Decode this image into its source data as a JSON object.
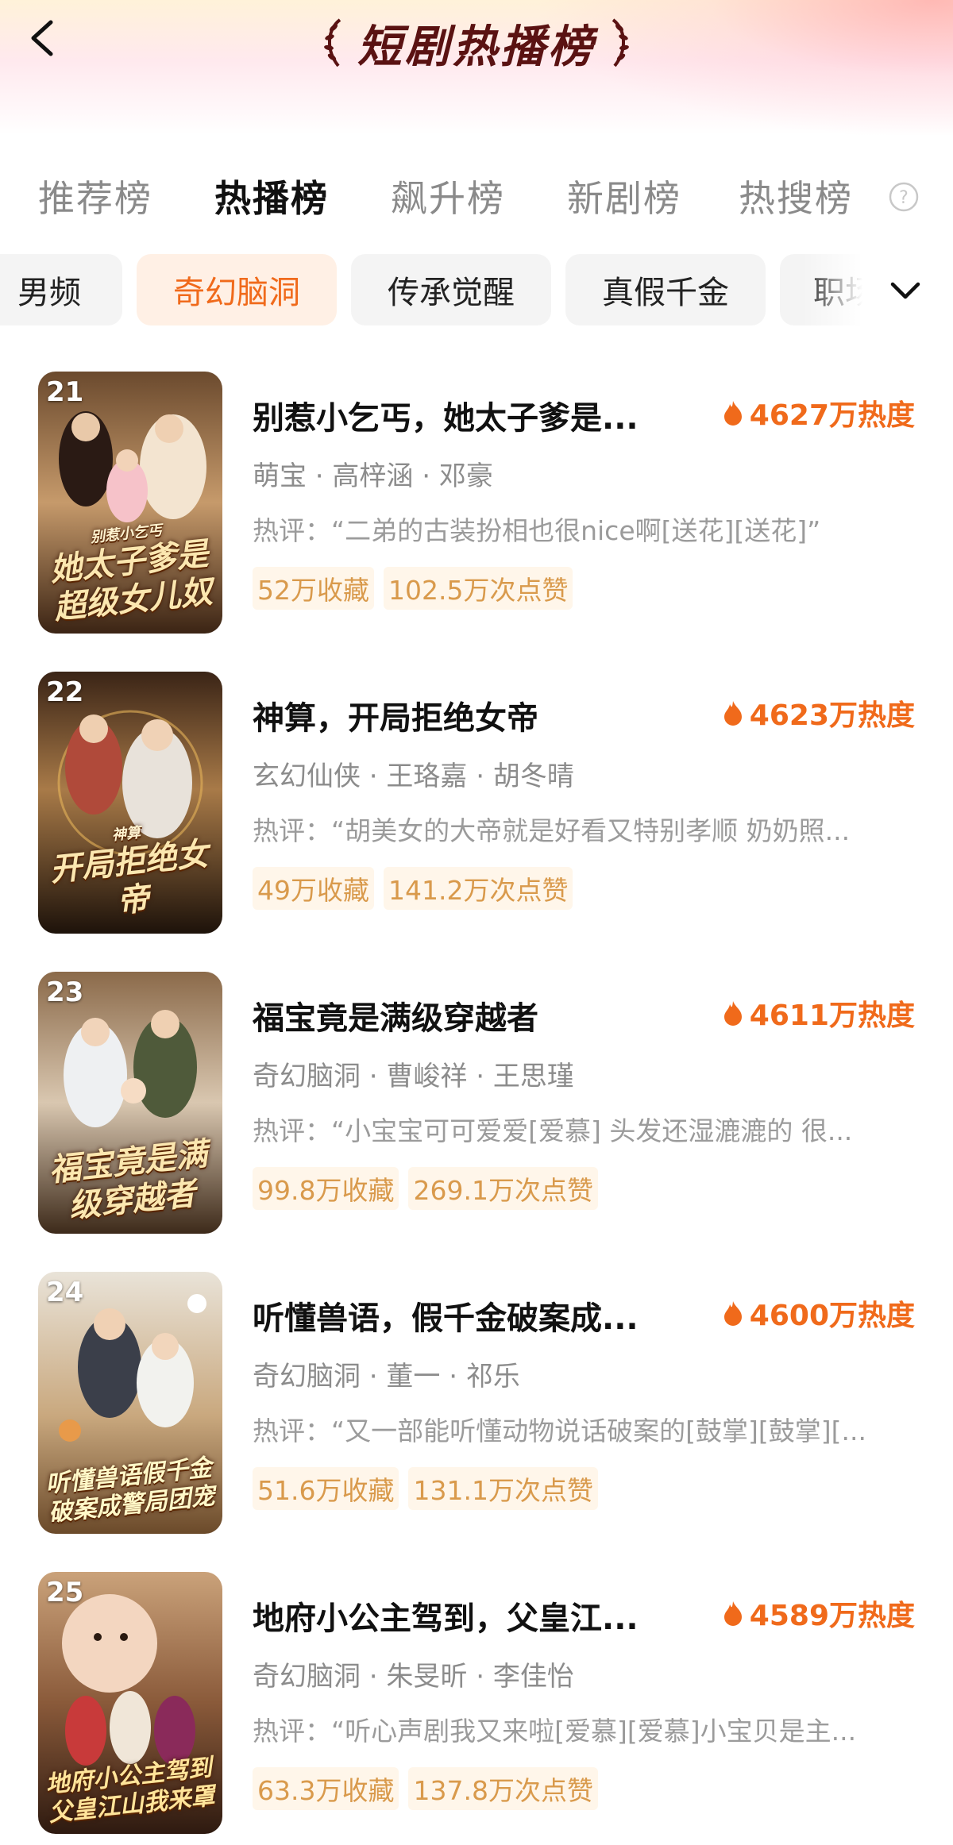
{
  "header": {
    "title": "短剧热播榜"
  },
  "rank_tabs": [
    "推荐榜",
    "热播榜",
    "飙升榜",
    "新剧榜",
    "热搜榜"
  ],
  "active_rank_tab": "热播榜",
  "categories": [
    "男频",
    "奇幻脑洞",
    "传承觉醒",
    "真假千金",
    "职场"
  ],
  "active_category": "奇幻脑洞",
  "items": [
    {
      "rank": "21",
      "title": "别惹小乞丐，她太子爹是...",
      "heat": "4627万热度",
      "tags": "萌宝 · 高梓涵 · 邓豪",
      "comment": "热评：“二弟的古装扮相也很nice啊[送花][送花]”",
      "favorites": "52万收藏",
      "likes": "102.5万次点赞",
      "poster_small": "别惹小乞丐",
      "poster_title": "她太子爹是超级女儿奴"
    },
    {
      "rank": "22",
      "title": "神算，开局拒绝女帝",
      "heat": "4623万热度",
      "tags": "玄幻仙侠 · 王珞嘉 · 胡冬晴",
      "comment": "热评：“胡美女的大帝就是好看又特别孝顺 奶奶照...",
      "favorites": "49万收藏",
      "likes": "141.2万次点赞",
      "poster_small": "神算",
      "poster_title": "开局拒绝女帝"
    },
    {
      "rank": "23",
      "title": "福宝竟是满级穿越者",
      "heat": "4611万热度",
      "tags": "奇幻脑洞 · 曹峻祥 · 王思瑾",
      "comment": "热评：“小宝宝可可爱爱[爱慕] 头发还湿漉漉的 很...",
      "favorites": "99.8万收藏",
      "likes": "269.1万次点赞",
      "poster_small": "",
      "poster_title": "福宝竟是满级穿越者"
    },
    {
      "rank": "24",
      "title": "听懂兽语，假千金破案成...",
      "heat": "4600万热度",
      "tags": "奇幻脑洞 · 董一 · 祁乐",
      "comment": "热评：“又一部能听懂动物说话破案的[鼓掌][鼓掌][...",
      "favorites": "51.6万收藏",
      "likes": "131.1万次点赞",
      "poster_small": "",
      "poster_title": "听懂兽语假千金破案成警局团宠"
    },
    {
      "rank": "25",
      "title": "地府小公主驾到，父皇江...",
      "heat": "4589万热度",
      "tags": "奇幻脑洞 · 朱旻昕 · 李佳怡",
      "comment": "热评：“听心声剧我又来啦[爱慕][爱慕]小宝贝是主...",
      "favorites": "63.3万收藏",
      "likes": "137.8万次点赞",
      "poster_small": "",
      "poster_title": "地府小公主驾到父皇江山我来罩"
    }
  ],
  "colors": {
    "accent": "#f06a1b",
    "stat_bg": "#fff6ea",
    "stat_text": "#d99a4c",
    "title_dark": "#5a1212"
  }
}
